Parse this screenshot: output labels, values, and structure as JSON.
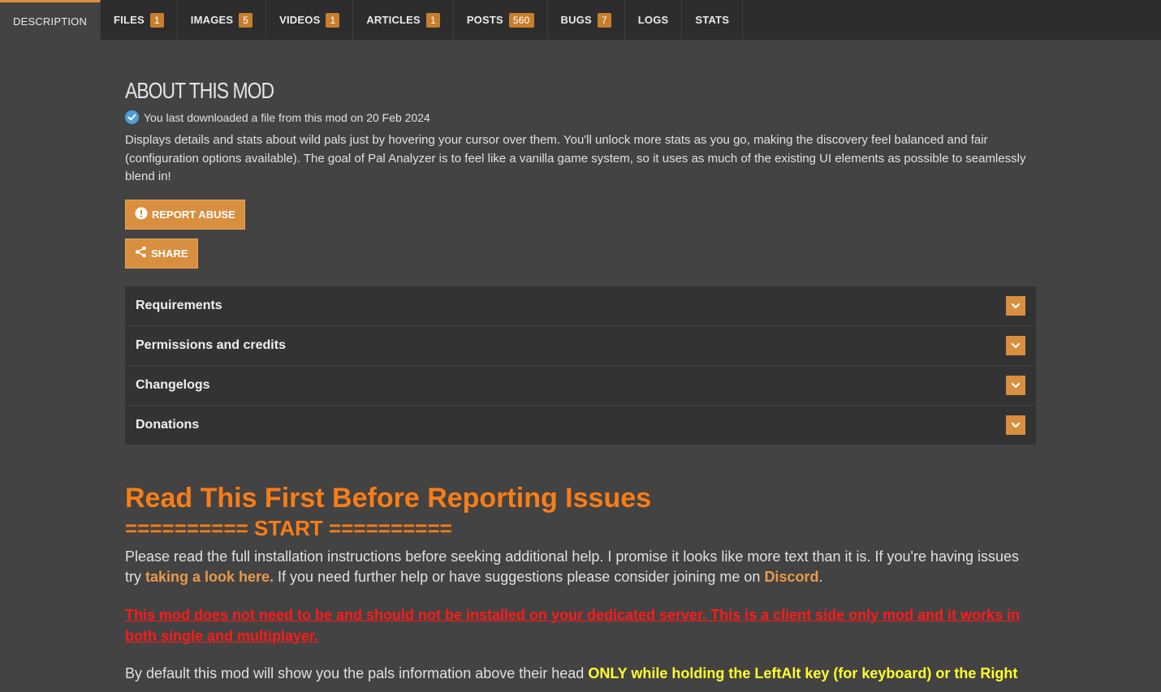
{
  "tabs": [
    {
      "label": "DESCRIPTION",
      "badge": null,
      "active": true
    },
    {
      "label": "FILES",
      "badge": "1"
    },
    {
      "label": "IMAGES",
      "badge": "5"
    },
    {
      "label": "VIDEOS",
      "badge": "1"
    },
    {
      "label": "ARTICLES",
      "badge": "1"
    },
    {
      "label": "POSTS",
      "badge": "560"
    },
    {
      "label": "BUGS",
      "badge": "7"
    },
    {
      "label": "LOGS",
      "badge": null
    },
    {
      "label": "STATS",
      "badge": null
    }
  ],
  "about": {
    "title": "ABOUT THIS MOD",
    "download_note": "You last downloaded a file from this mod on 20 Feb 2024",
    "description": "Displays details and stats about wild pals just by hovering your cursor over them. You'll unlock more stats as you go, making the discovery feel balanced and fair (configuration options available). The goal of Pal Analyzer is to feel like a vanilla game system, so it uses as much of the existing UI elements as possible to seamlessly blend in!",
    "report_label": "REPORT ABUSE",
    "share_label": "SHARE"
  },
  "accordion": [
    {
      "label": "Requirements"
    },
    {
      "label": "Permissions and credits"
    },
    {
      "label": "Changelogs"
    },
    {
      "label": "Donations"
    }
  ],
  "article": {
    "title": "Read This First Before Reporting Issues",
    "start_marker": "========== START ==========",
    "para1_a": "Please read the full installation instructions before seeking additional help.  I promise it looks like more text than it is.  If you're having issues try ",
    "para1_link1": "taking a look here.",
    "para1_b": "  If you need further help or have suggestions please consider joining me on ",
    "para1_link2": "Discord",
    "para1_c": ".",
    "warning": "This mod does not need to be and should not be installed on your dedicated server.  This is a client side only mod and it works in both single and multiplayer.",
    "para2_a": "By default this mod will show you the pals information above their head ",
    "para2_highlight": "ONLY while holding the LeftAlt key (for keyboard) or the Right"
  },
  "colors": {
    "accent": "#d98f40",
    "heading": "#f97d16",
    "warning": "#ff1a1a",
    "highlight": "#ffff2e"
  }
}
